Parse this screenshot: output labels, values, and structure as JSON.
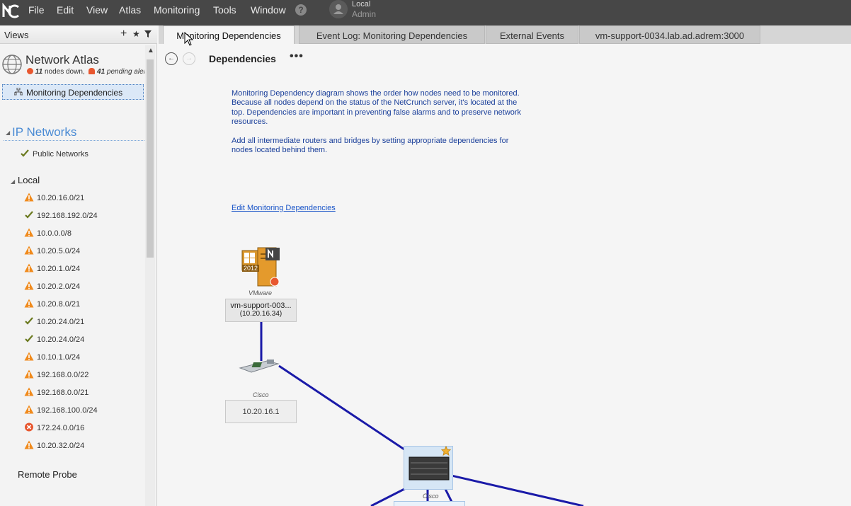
{
  "menu": {
    "items": [
      {
        "label": "File"
      },
      {
        "label": "Edit"
      },
      {
        "label": "View"
      },
      {
        "label": "Atlas"
      },
      {
        "label": "Monitoring"
      },
      {
        "label": "Tools"
      },
      {
        "label": "Window"
      }
    ],
    "help_icon": "?",
    "user": {
      "line1": "Local",
      "line2": "Admin"
    }
  },
  "views": {
    "title": "Views",
    "add_label": "+",
    "favorite_label": "★",
    "filter_icon": "filter-icon"
  },
  "atlas": {
    "title": "Network Atlas",
    "nodes_down": "11",
    "nodes_down_label": "nodes down,",
    "pending_alerts": "41",
    "pending_alerts_label": "pending aler"
  },
  "selected_view": {
    "label": "Monitoring Dependencies"
  },
  "ip_networks": {
    "title": "IP Networks",
    "public": {
      "label": "Public Networks",
      "status": "ok"
    }
  },
  "local": {
    "title": "Local",
    "items": [
      {
        "label": "10.20.16.0/21",
        "status": "warning"
      },
      {
        "label": "192.168.192.0/24",
        "status": "ok"
      },
      {
        "label": "10.0.0.0/8",
        "status": "warning"
      },
      {
        "label": "10.20.5.0/24",
        "status": "warning"
      },
      {
        "label": "10.20.1.0/24",
        "status": "warning"
      },
      {
        "label": "10.20.2.0/24",
        "status": "warning"
      },
      {
        "label": "10.20.8.0/21",
        "status": "warning"
      },
      {
        "label": "10.20.24.0/21",
        "status": "ok"
      },
      {
        "label": "10.20.24.0/24",
        "status": "ok"
      },
      {
        "label": "10.10.1.0/24",
        "status": "warning"
      },
      {
        "label": "192.168.0.0/22",
        "status": "warning"
      },
      {
        "label": "192.168.0.0/21",
        "status": "warning"
      },
      {
        "label": "192.168.100.0/24",
        "status": "warning"
      },
      {
        "label": "172.24.0.0/16",
        "status": "error"
      },
      {
        "label": "10.20.32.0/24",
        "status": "warning"
      }
    ]
  },
  "remote_probe": {
    "title": "Remote Probe"
  },
  "tabs": [
    {
      "label": "Monitoring Dependencies",
      "active": true
    },
    {
      "label": "Event Log: Monitoring Dependencies",
      "active": false
    },
    {
      "label": "External Events",
      "active": false
    },
    {
      "label": "vm-support-0034.lab.ad.adrem:3000",
      "active": false
    }
  ],
  "toolbar": {
    "back": "←",
    "forward": "→",
    "title": "Dependencies",
    "more": "•••"
  },
  "content": {
    "description_p1": "Monitoring Dependency diagram shows the order how nodes need to be monitored. Because all nodes depend on the status of the NetCrunch server, it's located at the top. Dependencies are important in preventing false alarms and to preserve network resources.",
    "description_p2": "Add all intermediate routers and bridges by setting appropriate dependencies for nodes located behind them.",
    "edit_link": "Edit Monitoring Dependencies"
  },
  "nodes": {
    "server": {
      "vendor": "VMware",
      "name": "vm-support-003...",
      "ip": "(10.20.16.34)",
      "badge": "2012"
    },
    "router": {
      "vendor": "Cisco",
      "ip": "10.20.16.1"
    },
    "switch": {
      "vendor": "Cisco"
    }
  },
  "colors": {
    "menubar": "#474747",
    "link": "#1a55c8",
    "description": "#1a3f9a",
    "connection": "#1a1aa8",
    "warning": "#f08a1c",
    "ok": "#6b7a1f",
    "error": "#e8572f"
  }
}
